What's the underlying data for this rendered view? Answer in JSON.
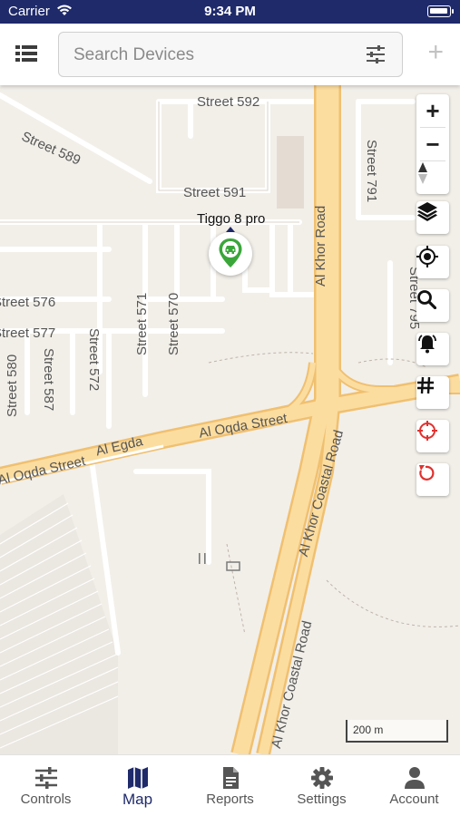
{
  "status_bar": {
    "carrier": "Carrier",
    "time": "9:34 PM"
  },
  "header": {
    "search_placeholder": "Search Devices",
    "icons": {
      "list": "list-icon",
      "filter": "sliders-icon",
      "add": "plus-icon"
    }
  },
  "map": {
    "street_labels": [
      "Street 592",
      "Street 589",
      "Street 591",
      "Street 576",
      "Street 577",
      "Street 572",
      "Street 571",
      "Street 570",
      "Street 580",
      "Street 587",
      "Street 791",
      "Street 795",
      "Al Khor Road",
      "Al Egda",
      "Al Oqda Street",
      "Al Oqda Street",
      "Al Khor Coastal Road",
      "Al Khor Coastal Road"
    ],
    "device": {
      "name": "Tiggo 8 pro",
      "status_color": "#3aa63a"
    },
    "scale_label": "200 m",
    "controls": [
      "zoom-in-icon",
      "zoom-out-icon",
      "compass-icon",
      "layers-icon",
      "locate-icon",
      "search-icon",
      "alarm-icon",
      "grid-icon",
      "target-icon",
      "refresh-icon"
    ]
  },
  "tabs": [
    {
      "label": "Controls",
      "icon": "sliders-icon",
      "active": false
    },
    {
      "label": "Map",
      "icon": "map-icon",
      "active": true
    },
    {
      "label": "Reports",
      "icon": "document-icon",
      "active": false
    },
    {
      "label": "Settings",
      "icon": "gear-icon",
      "active": false
    },
    {
      "label": "Account",
      "icon": "person-icon",
      "active": false
    }
  ],
  "colors": {
    "brand": "#1f2a6b",
    "road_major": "#f6cf86",
    "road_fill": "#fce3a8",
    "danger": "#e0312e"
  }
}
